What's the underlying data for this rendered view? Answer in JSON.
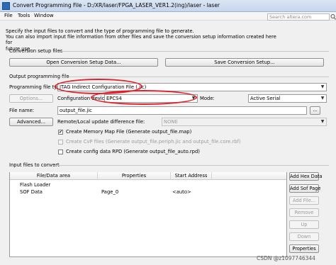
{
  "window": {
    "title": "Convert Programming File - D:/XR/laser/FPGA_LASER_VER1.2(ing)/laser - laser"
  },
  "menu": {
    "file": "File",
    "tools": "Tools",
    "window": "Window"
  },
  "search": {
    "placeholder": "Search altera.com"
  },
  "description": {
    "line1": "Specify the input files to convert and the type of programming file to generate.",
    "line2": "You can also import input file information from other files and save the conversion setup information created here for",
    "line3": "future use."
  },
  "conversion_setup": {
    "label": "Conversion setup files",
    "open_button": "Open Conversion Setup Data...",
    "save_button": "Save Conversion Setup..."
  },
  "output": {
    "label": "Output programming file",
    "programming_file_type_label": "Programming file type:",
    "programming_file_type_value": "JTAG Indirect Configuration File (.jic)",
    "options_button": "Options...",
    "configuration_device_label": "Configuration device:",
    "configuration_device_value": "EPCS4",
    "mode_label": "Mode:",
    "mode_value": "Active Serial",
    "file_name_label": "File name:",
    "file_name_value": "output_file.jic",
    "browse_button": "...",
    "advanced_button": "Advanced...",
    "remote_label": "Remote/Local update difference file:",
    "remote_value": "NONE",
    "check_memory_map": "Create Memory Map File (Generate output_file.map)",
    "check_cvp": "Create CvP files (Generate output_file.periph.jic and output_file.core.rbf)",
    "check_rpd": "Create config data RPD (Generate output_file_auto.rpd)"
  },
  "input_files": {
    "label": "Input files to convert",
    "columns": [
      "File/Data area",
      "Properties",
      "Start Address"
    ],
    "rows": [
      {
        "name": "Flash Loader",
        "properties": "",
        "address": ""
      },
      {
        "name": "SOF Data",
        "properties": "Page_0",
        "address": "<auto>"
      }
    ]
  },
  "side_buttons": {
    "add_hex": "Add Hex Data",
    "add_sof": "Add Sof Page",
    "add_file": "Add File...",
    "remove": "Remove",
    "up": "Up",
    "down": "Down",
    "properties": "Properties"
  },
  "watermark": "CSDN @z1097746344",
  "colors": {
    "annotation": "#e0202a",
    "title_bar": "#c5d6ec"
  }
}
